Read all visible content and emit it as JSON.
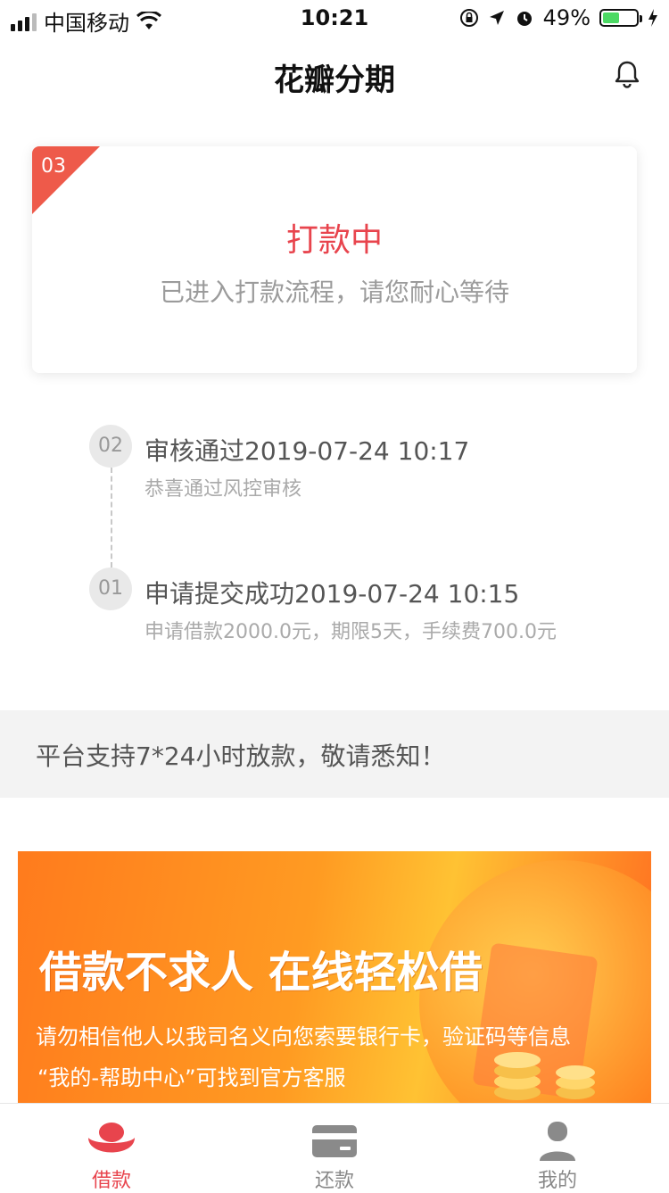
{
  "status_bar": {
    "carrier": "中国移动",
    "time": "10:21",
    "battery": "49%",
    "battery_level": 0.49
  },
  "nav": {
    "title": "花瓣分期"
  },
  "status_card": {
    "step": "03",
    "title": "打款中",
    "subtitle": "已进入打款流程，请您耐心等待"
  },
  "timeline": [
    {
      "num": "02",
      "title": "审核通过2019-07-24 10:17",
      "desc": "恭喜通过风控审核"
    },
    {
      "num": "01",
      "title": "申请提交成功2019-07-24 10:15",
      "desc": "申请借款2000.0元，期限5天，手续费700.0元"
    }
  ],
  "notice": "平台支持7*24小时放款，敬请悉知！",
  "banner": {
    "title": "借款不求人 在线轻松借",
    "line1": "请勿相信他人以我司名义向您索要银行卡，验证码等信息",
    "line2": "“我的-帮助中心”可找到官方客服"
  },
  "tabbar": {
    "borrow": "借款",
    "repay": "还款",
    "mine": "我的"
  },
  "colors": {
    "accent": "#e8444d",
    "corner": "#ee5a4a"
  }
}
